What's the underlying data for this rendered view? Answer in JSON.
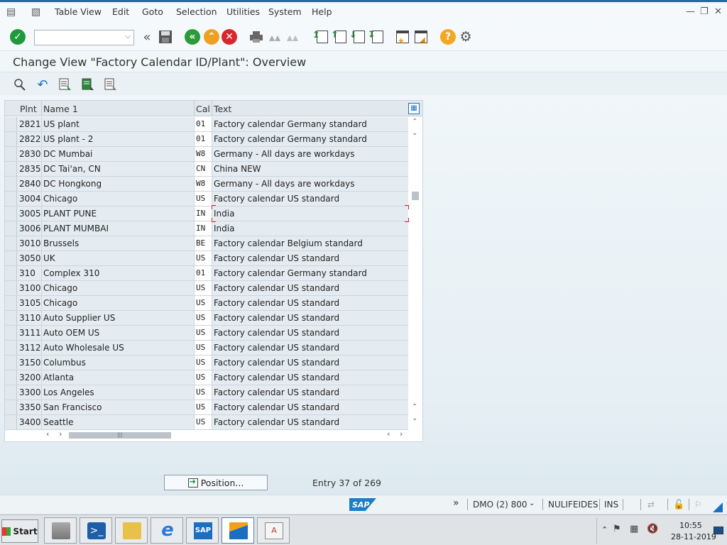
{
  "menubar": {
    "items": [
      "Table View",
      "Edit",
      "Goto",
      "Selection",
      "Utilities",
      "System",
      "Help"
    ]
  },
  "title": "Change View \"Factory Calendar ID/Plant\": Overview",
  "table": {
    "columns": [
      "Plnt",
      "Name 1",
      "Cal",
      "Text"
    ],
    "rows": [
      {
        "plnt": "2821",
        "name": "US plant",
        "cal": "01",
        "text": "Factory calendar Germany standard"
      },
      {
        "plnt": "2822",
        "name": "US plant - 2",
        "cal": "01",
        "text": "Factory calendar Germany standard"
      },
      {
        "plnt": "2830",
        "name": "DC Mumbai",
        "cal": "W8",
        "text": "Germany - All days are workdays"
      },
      {
        "plnt": "2835",
        "name": "DC Tai'an, CN",
        "cal": "CN",
        "text": "China NEW"
      },
      {
        "plnt": "2840",
        "name": "DC Hongkong",
        "cal": "W8",
        "text": "Germany - All days are workdays"
      },
      {
        "plnt": "3004",
        "name": "Chicago",
        "cal": "US",
        "text": "Factory calendar US standard"
      },
      {
        "plnt": "3005",
        "name": "PLANT PUNE",
        "cal": "IN",
        "text": "India"
      },
      {
        "plnt": "3006",
        "name": "PLANT MUMBAI",
        "cal": "IN",
        "text": "India"
      },
      {
        "plnt": "3010",
        "name": "Brussels",
        "cal": "BE",
        "text": "Factory calendar Belgium standard"
      },
      {
        "plnt": "3050",
        "name": "UK",
        "cal": "US",
        "text": "Factory calendar US standard"
      },
      {
        "plnt": "310",
        "name": "Complex 310",
        "cal": "01",
        "text": "Factory calendar Germany standard"
      },
      {
        "plnt": "3100",
        "name": "Chicago",
        "cal": "US",
        "text": "Factory calendar US standard"
      },
      {
        "plnt": "3105",
        "name": "Chicago",
        "cal": "US",
        "text": "Factory calendar US standard"
      },
      {
        "plnt": "3110",
        "name": "Auto Supplier US",
        "cal": "US",
        "text": "Factory calendar US standard"
      },
      {
        "plnt": "3111",
        "name": "Auto OEM US",
        "cal": "US",
        "text": "Factory calendar US standard"
      },
      {
        "plnt": "3112",
        "name": "Auto Wholesale US",
        "cal": "US",
        "text": "Factory calendar US standard"
      },
      {
        "plnt": "3150",
        "name": "Columbus",
        "cal": "US",
        "text": "Factory calendar US standard"
      },
      {
        "plnt": "3200",
        "name": "Atlanta",
        "cal": "US",
        "text": "Factory calendar US standard"
      },
      {
        "plnt": "3300",
        "name": "Los Angeles",
        "cal": "US",
        "text": "Factory calendar US standard"
      },
      {
        "plnt": "3350",
        "name": "San Francisco",
        "cal": "US",
        "text": "Factory calendar US standard"
      },
      {
        "plnt": "3400",
        "name": "Seattle",
        "cal": "US",
        "text": "Factory calendar US standard"
      }
    ]
  },
  "footer": {
    "position_label": "Position...",
    "entry_info": "Entry 37 of 269"
  },
  "statusbar": {
    "system": "DMO (2) 800",
    "host": "NULIFEIDES",
    "mode": "INS",
    "logo": "SAP"
  },
  "taskbar": {
    "start_label": "Start",
    "time": "10:55",
    "date": "28-11-2019"
  },
  "colors": {
    "accent": "#1e6f9f",
    "ok_green": "#1e9a3c",
    "back_green": "#2a9a3a",
    "exit_orange": "#f0a020",
    "cancel_red": "#d9262c",
    "help_yellow": "#f5a623"
  },
  "icons": [
    "menu-icon",
    "layout-icon",
    "enter-icon",
    "back-icon",
    "save-icon",
    "exit-icon",
    "cancel-icon",
    "print-icon",
    "find-icon",
    "help-icon",
    "settings-icon"
  ]
}
